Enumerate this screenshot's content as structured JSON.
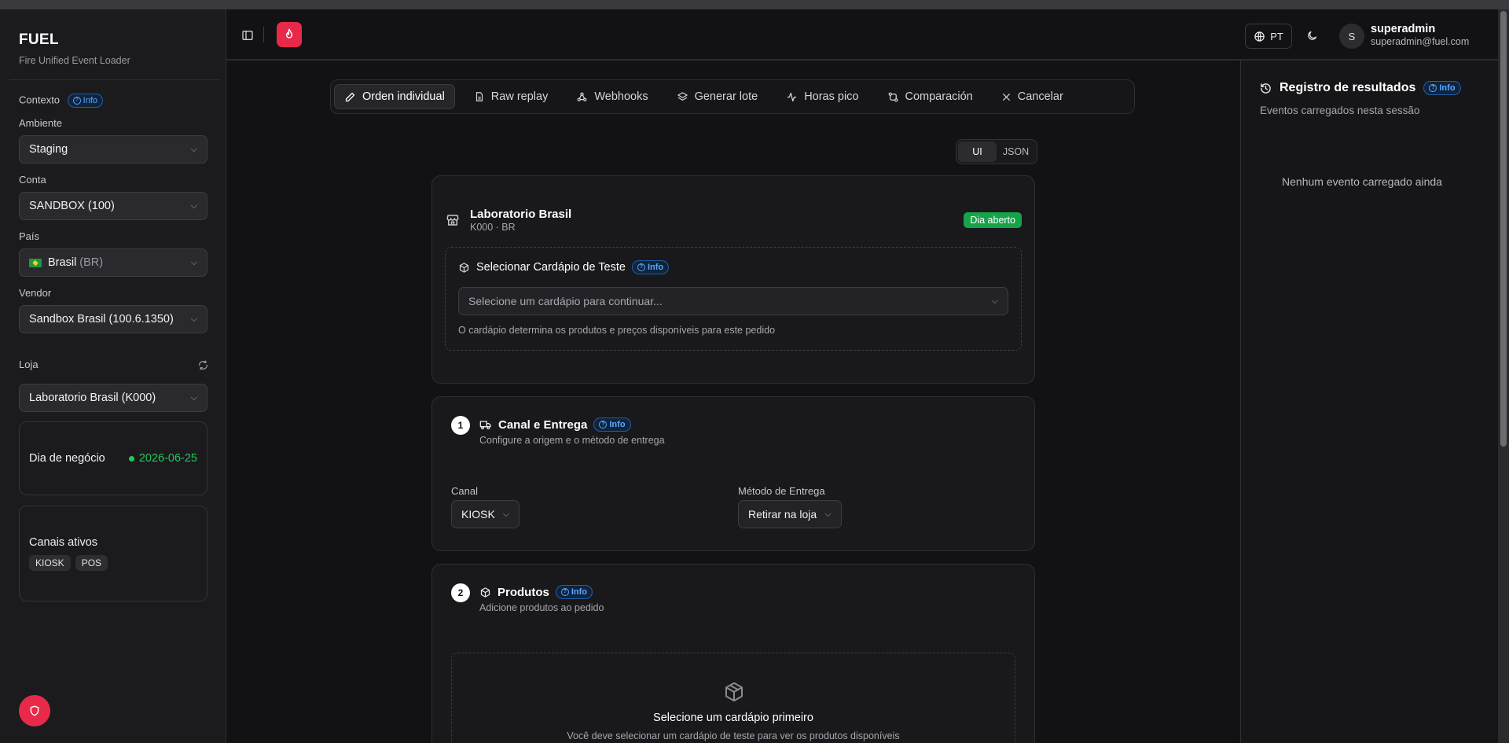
{
  "sidebar": {
    "app_name": "FUEL",
    "app_subtitle": "Fire Unified Event Loader",
    "context_label": "Contexto",
    "info_label": "Info",
    "ambiente_label": "Ambiente",
    "ambiente_value": "Staging",
    "conta_label": "Conta",
    "conta_value": "SANDBOX (100)",
    "pais_label": "País",
    "pais_value": "Brasil",
    "pais_code": "(BR)",
    "vendor_label": "Vendor",
    "vendor_value": "Sandbox Brasil (100.6.1350)",
    "loja_label": "Loja",
    "loja_value": "Laboratorio Brasil (K000)",
    "business_day_label": "Dia de negócio",
    "business_day_value": "2026-06-25",
    "channels_label": "Canais ativos",
    "channels": [
      "KIOSK",
      "POS"
    ]
  },
  "header": {
    "language": "PT",
    "user_initial": "S",
    "user_name": "superadmin",
    "user_email": "superadmin@fuel.com"
  },
  "tabs": [
    {
      "label": "Orden individual",
      "icon": "pencil-icon"
    },
    {
      "label": "Raw replay",
      "icon": "file-icon"
    },
    {
      "label": "Webhooks",
      "icon": "webhook-icon"
    },
    {
      "label": "Generar lote",
      "icon": "layers-icon"
    },
    {
      "label": "Horas pico",
      "icon": "activity-icon"
    },
    {
      "label": "Comparación",
      "icon": "compare-icon"
    },
    {
      "label": "Cancelar",
      "icon": "close-icon"
    }
  ],
  "view_toggle": {
    "ui": "UI",
    "json": "JSON"
  },
  "store": {
    "name": "Laboratorio Brasil",
    "code": "K000 · BR",
    "status": "Dia aberto",
    "menu_title": "Selecionar Cardápio de Teste",
    "menu_placeholder": "Selecione um cardápio para continuar...",
    "menu_hint": "O cardápio determina os produtos e preços disponíveis para este pedido"
  },
  "step1": {
    "number": "1",
    "title": "Canal e Entrega",
    "subtitle": "Configure a origem e o método de entrega",
    "channel_label": "Canal",
    "channel_value": "KIOSK",
    "delivery_label": "Método de Entrega",
    "delivery_value": "Retirar na loja"
  },
  "step2": {
    "number": "2",
    "title": "Produtos",
    "subtitle": "Adicione produtos ao pedido",
    "empty_title": "Selecione um cardápio primeiro",
    "empty_text": "Você deve selecionar um cardápio de teste para ver os produtos disponíveis"
  },
  "results": {
    "title": "Registro de resultados",
    "subtitle": "Eventos carregados nesta sessão",
    "empty": "Nenhum evento carregado ainda"
  },
  "colors": {
    "accent": "#e8294a",
    "info": "#5aa8ff",
    "success": "#16a34a",
    "background": "#121214"
  }
}
